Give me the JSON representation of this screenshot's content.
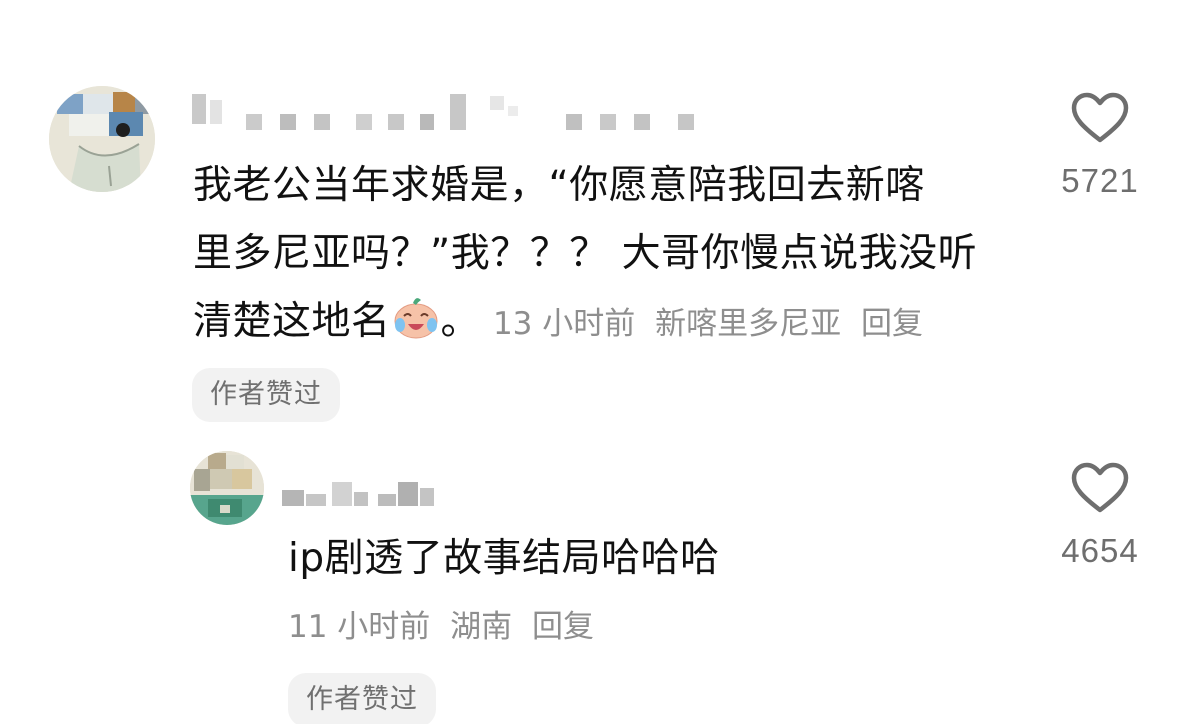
{
  "comments": [
    {
      "text_line1": "我老公当年求婚是，“你愿意陪我回去新喀",
      "text_line2": "里多尼亚吗？”我？？？ 大哥你慢点说我没听",
      "text_line3": "清楚这地名",
      "text_end": "。",
      "emoji": "crying-laughing-face-icon",
      "time": "13 小时前",
      "location": "新喀里多尼亚",
      "reply_label": "回复",
      "badge": "作者赞过",
      "like_count": "5721"
    },
    {
      "text": "ip剧透了故事结局哈哈哈",
      "time": "11 小时前",
      "location": "湖南",
      "reply_label": "回复",
      "badge": "作者赞过",
      "like_count": "4654"
    }
  ],
  "colors": {
    "text": "#111111",
    "meta": "#8e8e8e",
    "badge_bg": "#f2f2f2",
    "heart": "#6e6e6e"
  }
}
